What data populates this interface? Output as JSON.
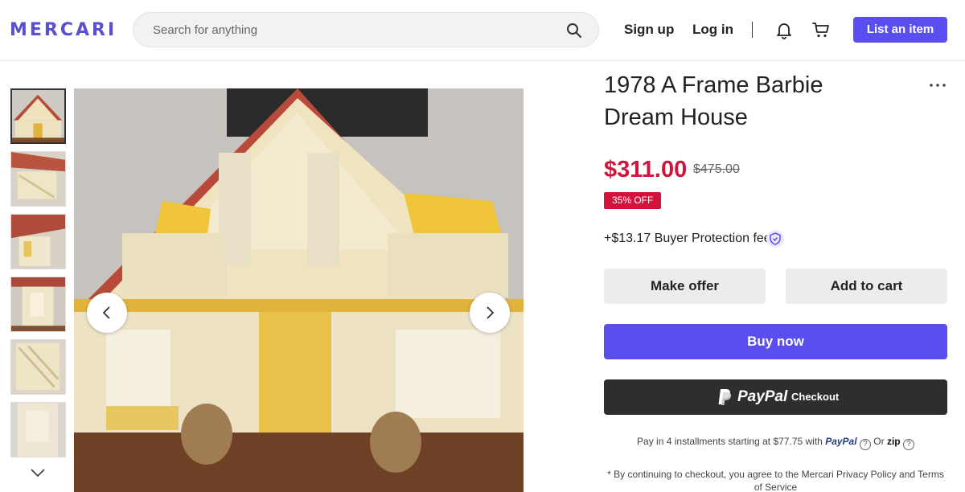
{
  "header": {
    "logo": "MERCARI",
    "search_placeholder": "Search for anything",
    "sign_up": "Sign up",
    "log_in": "Log in",
    "list_item": "List an item",
    "icons": [
      "search-icon",
      "bell-icon",
      "cart-icon"
    ]
  },
  "gallery": {
    "thumbnail_count": 6,
    "active_index": 0,
    "icons": [
      "chevron-down-icon",
      "chevron-left-icon",
      "chevron-right-icon"
    ]
  },
  "product": {
    "title": "1978 A Frame Barbie Dream House",
    "price": "$311.00",
    "original_price": "$475.00",
    "discount_badge": "35% OFF",
    "buyer_protection_fee": "+$13.17 Buyer Protection fee",
    "make_offer": "Make offer",
    "add_to_cart": "Add to cart",
    "buy_now": "Buy now",
    "paypal_brand": "PayPal",
    "paypal_checkout": "Checkout",
    "installments_text": "Pay in 4 installments starting at $77.75 with",
    "installments_paypal": "PayPal",
    "installments_or": "Or",
    "installments_zip": "zip",
    "disclaimer": "* By continuing to checkout, you agree to the Mercari Privacy Policy and Terms of Service"
  },
  "colors": {
    "brand": "#5a4fee",
    "price_red": "#d2133b",
    "paypal_dark": "#2c2e2f"
  }
}
